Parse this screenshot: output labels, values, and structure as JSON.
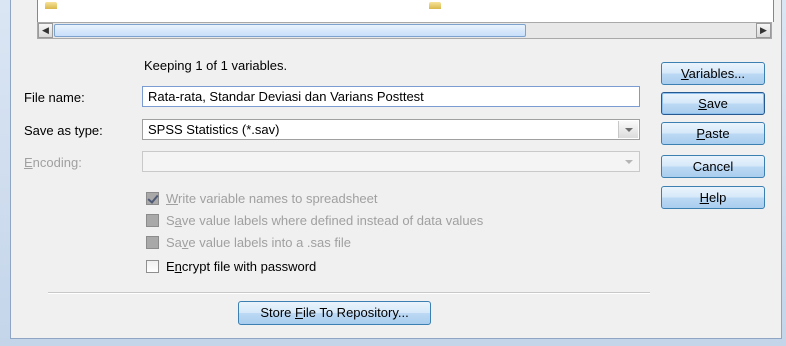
{
  "status_text": "Keeping 1 of 1 variables.",
  "file_name": {
    "label": "File name:",
    "label_accel": "",
    "value": "Rata-rata, Standar Deviasi dan Varians Posttest"
  },
  "save_as_type": {
    "label": "Save as type:",
    "value": "SPSS Statistics (*.sav)"
  },
  "encoding": {
    "label_accel": "E",
    "label_rest": "ncoding:",
    "value": ""
  },
  "options": [
    {
      "pre": "",
      "accel": "W",
      "post": "rite variable names to spreadsheet",
      "checked": true,
      "enabled": false
    },
    {
      "pre": "S",
      "accel": "a",
      "post": "ve value labels where defined instead of data values",
      "checked": false,
      "enabled": false
    },
    {
      "pre": "Sa",
      "accel": "v",
      "post": "e value labels into a .sas file",
      "checked": false,
      "enabled": false
    },
    {
      "pre": "E",
      "accel": "n",
      "post": "crypt file with password",
      "checked": false,
      "enabled": true
    }
  ],
  "buttons": {
    "variables": {
      "accel": "V",
      "rest": "ariables..."
    },
    "save": {
      "accel": "S",
      "rest": "ave"
    },
    "paste": {
      "accel": "P",
      "rest": "aste"
    },
    "cancel": "Cancel",
    "help": {
      "accel": "H",
      "rest": "elp"
    },
    "repository": {
      "pre": "Store ",
      "accel": "F",
      "post": "ile To Repository..."
    }
  },
  "icons": {
    "scroll_left": "◀",
    "scroll_right": "▶"
  }
}
